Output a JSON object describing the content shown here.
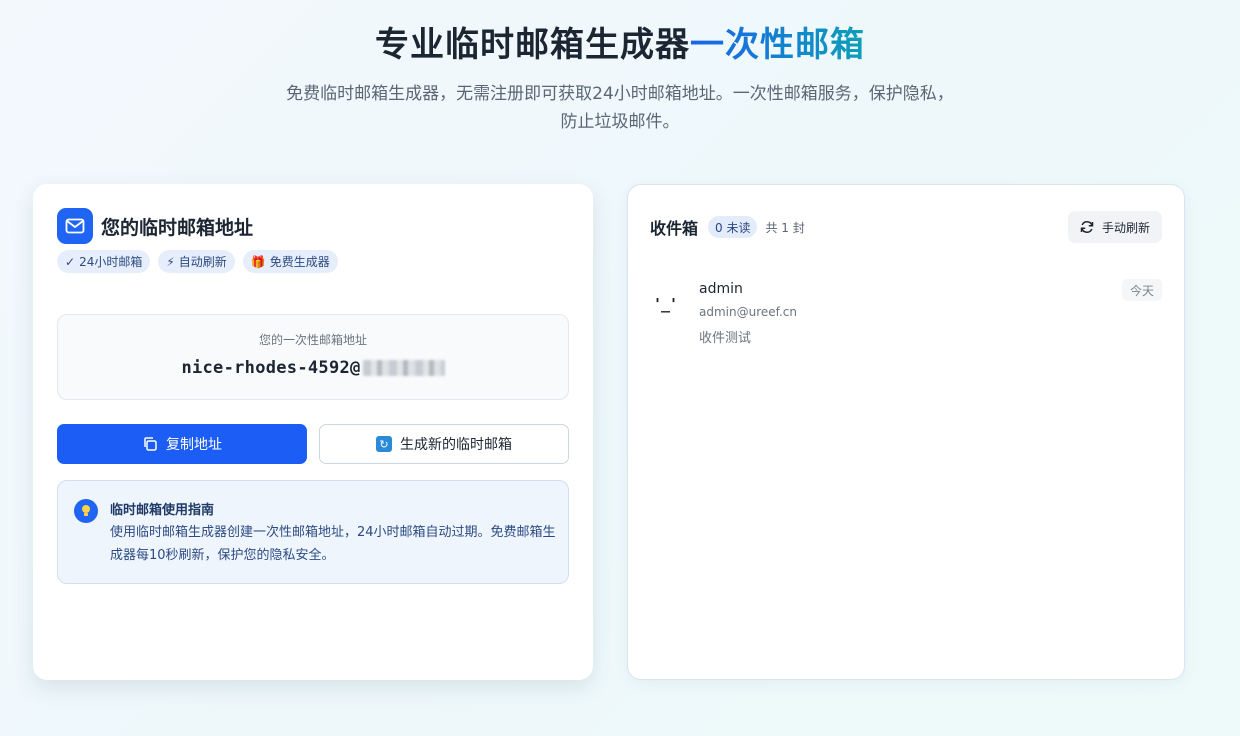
{
  "hero": {
    "title_main": "专业临时邮箱生成器",
    "title_accent": "一次性邮箱",
    "subtitle": "免费临时邮箱生成器，无需注册即可获取24小时邮箱地址。一次性邮箱服务，保护隐私，防止垃圾邮件。"
  },
  "colors": {
    "primary": "#1c5ef5",
    "accent_gradient_start": "#1a63e8",
    "accent_gradient_end": "#0e9fb8",
    "tag_bg": "#e6eefb",
    "guide_bg": "#eef5fd"
  },
  "mailbox": {
    "title": "您的临时邮箱地址",
    "icon": "mail-icon",
    "tags": [
      {
        "icon": "✓",
        "label": "24小时邮箱"
      },
      {
        "icon": "⚡",
        "label": "自动刷新"
      },
      {
        "icon": "🎁",
        "label": "免费生成器"
      }
    ],
    "address_caption": "您的一次性邮箱地址",
    "address_local": "nice-rhodes-4592@",
    "copy_button": "复制地址",
    "new_button": "生成新的临时邮箱",
    "guide": {
      "title": "临时邮箱使用指南",
      "text": "使用临时邮箱生成器创建一次性邮箱地址，24小时邮箱自动过期。免费邮箱生成器每10秒刷新，保护您的隐私安全。"
    }
  },
  "inbox": {
    "title": "收件箱",
    "unread": "0 未读",
    "total": "共 1 封",
    "refresh_button": "手动刷新",
    "messages": [
      {
        "avatar": "'_'",
        "from": "admin",
        "address": "admin@ureef.cn",
        "subject": "收件测试",
        "date": "今天"
      }
    ]
  }
}
